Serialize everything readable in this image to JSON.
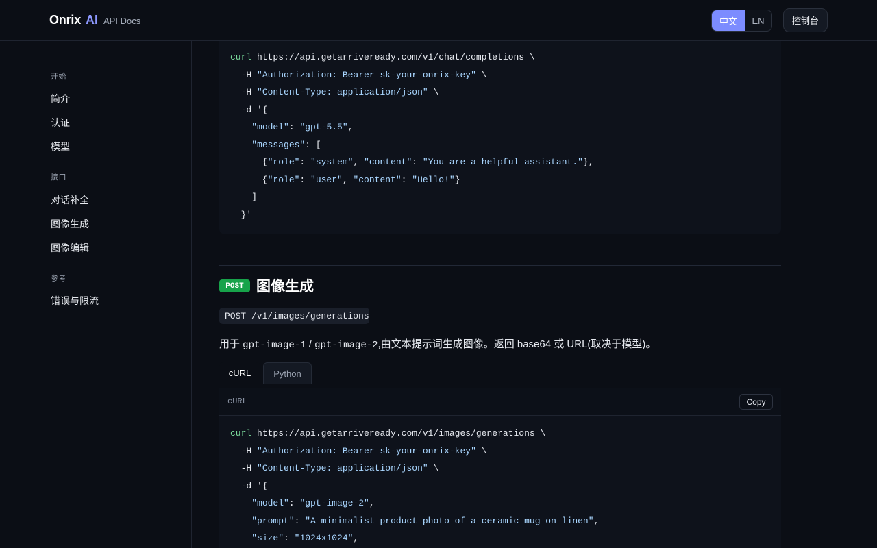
{
  "header": {
    "brand_name": "Onrix",
    "brand_ai": "AI",
    "brand_sub": "API Docs",
    "lang_zh": "中文",
    "lang_en": "EN",
    "console_label": "控制台"
  },
  "sidebar": {
    "sections": [
      {
        "title": "开始",
        "items": [
          "简介",
          "认证",
          "模型"
        ]
      },
      {
        "title": "接口",
        "items": [
          "对话补全",
          "图像生成",
          "图像编辑"
        ]
      },
      {
        "title": "参考",
        "items": [
          "错误与限流"
        ]
      }
    ]
  },
  "code_top": {
    "lines": [
      "curl https://api.getarriveready.com/v1/chat/completions \\",
      "  -H \"Authorization: Bearer sk-your-onrix-key\" \\",
      "  -H \"Content-Type: application/json\" \\",
      "  -d '{",
      "    \"model\": \"gpt-5.5\",",
      "    \"messages\": [",
      "      {\"role\": \"system\", \"content\": \"You are a helpful assistant.\"},",
      "      {\"role\": \"user\", \"content\": \"Hello!\"}",
      "    ]",
      "  }'"
    ]
  },
  "image_section": {
    "badge": "POST",
    "title": "图像生成",
    "endpoint": "POST /v1/images/generations",
    "desc_prefix": "用于 ",
    "desc_model1": "gpt-image-1",
    "desc_sep": " / ",
    "desc_model2": "gpt-image-2",
    "desc_suffix": ",由文本提示词生成图像。返回 base64 或 URL(取决于模型)。",
    "tabs": [
      "cURL",
      "Python"
    ],
    "code_lang": "cURL",
    "copy_label": "Copy",
    "code_lines": [
      "curl https://api.getarriveready.com/v1/images/generations \\",
      "  -H \"Authorization: Bearer sk-your-onrix-key\" \\",
      "  -H \"Content-Type: application/json\" \\",
      "  -d '{",
      "    \"model\": \"gpt-image-2\",",
      "    \"prompt\": \"A minimalist product photo of a ceramic mug on linen\",",
      "    \"size\": \"1024x1024\","
    ]
  },
  "colors": {
    "accent": "#7c8cff",
    "post_badge": "#17a34a",
    "keyword": "#79d89a",
    "string": "#a9d6ff"
  }
}
